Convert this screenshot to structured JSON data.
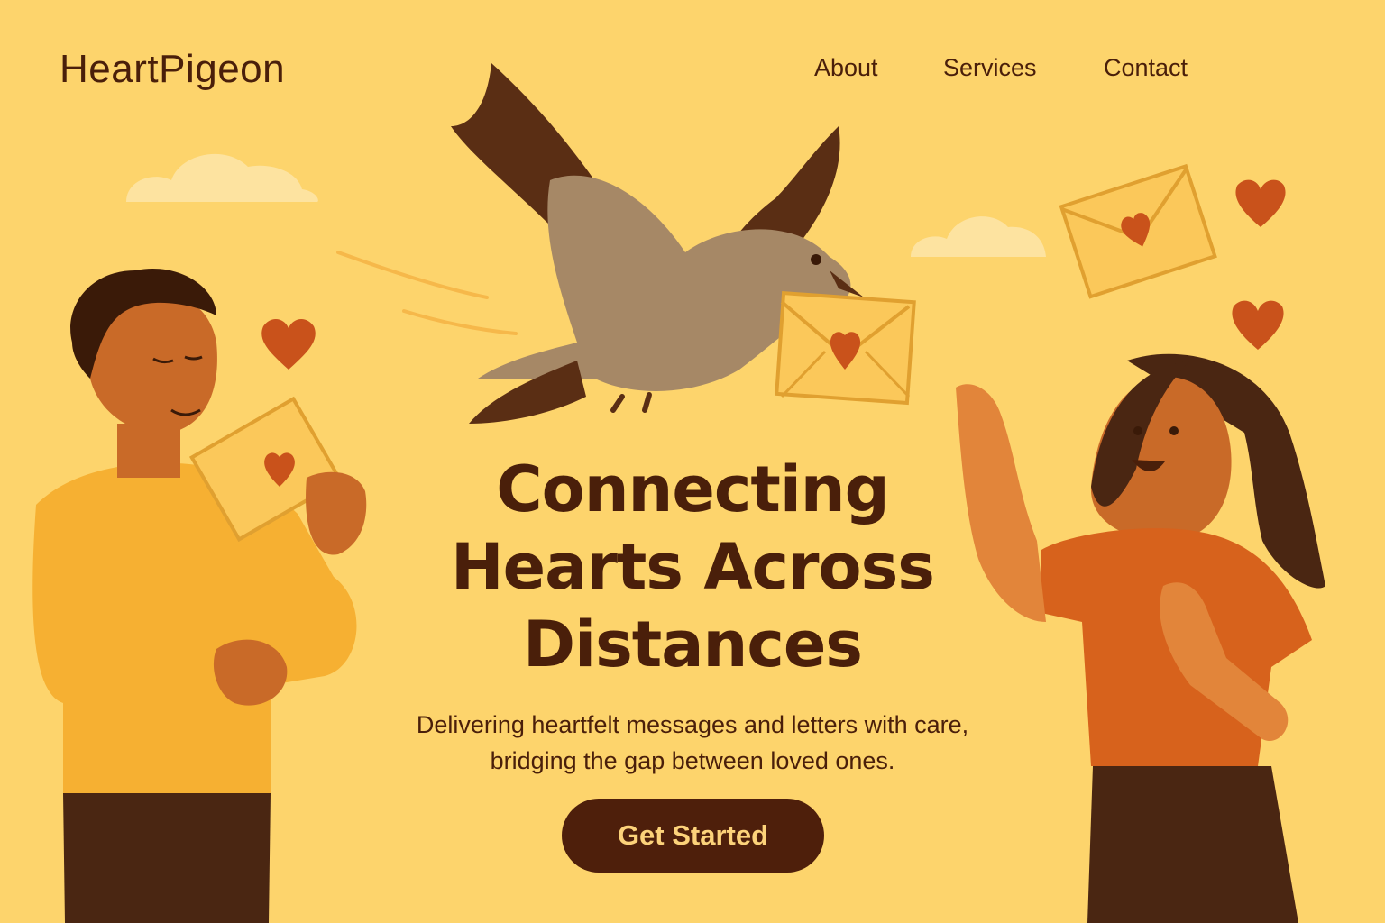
{
  "brand": {
    "name": "HeartPigeon"
  },
  "nav": {
    "items": [
      {
        "label": "About"
      },
      {
        "label": "Services"
      },
      {
        "label": "Contact"
      }
    ]
  },
  "hero": {
    "headline_lines": [
      "Connecting",
      "Hearts Across",
      "Distances"
    ],
    "subtitle_lines": [
      "Delivering heartfelt messages and letters with care,",
      "bridging the gap between loved ones."
    ],
    "cta_label": "Get Started"
  },
  "colors": {
    "background": "#fdd46c",
    "text": "#4a1f0a",
    "button": "#4e1f0b",
    "button_text": "#fcd27a",
    "heart": "#c9521b",
    "envelope": "#fbc85a"
  },
  "illustrations": {
    "pigeon": "pigeon-carrying-envelope",
    "left_person": "man-holding-envelope",
    "right_person": "woman-waving",
    "decor": [
      "cloud",
      "heart",
      "envelope"
    ]
  }
}
